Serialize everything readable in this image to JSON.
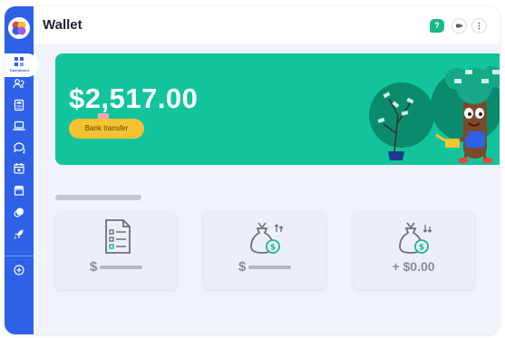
{
  "window": {
    "title": "Wallet"
  },
  "sidebar": {
    "active_label": "Dashboard",
    "icons": [
      "users-icon",
      "calculator-icon",
      "laptop-icon",
      "chat-icon",
      "calendar-icon",
      "store-icon",
      "coins-icon",
      "rocket-icon",
      "plus-circle-icon"
    ]
  },
  "topbar": {
    "help_label": "?"
  },
  "banner": {
    "balance": "$2,517.00",
    "bank_transfer_label": "Bank transfer"
  },
  "cards": [
    {
      "icon": "document-icon",
      "dollar": "$",
      "value": ""
    },
    {
      "icon": "money-bag-up-icon",
      "dollar": "$",
      "value": ""
    },
    {
      "icon": "money-bag-down-icon",
      "dollar": "",
      "value": "+ $0.00"
    }
  ],
  "colors": {
    "sidebar": "#2f61e6",
    "banner": "#12c49c",
    "button": "#f6c232",
    "help": "#1bb88a"
  }
}
